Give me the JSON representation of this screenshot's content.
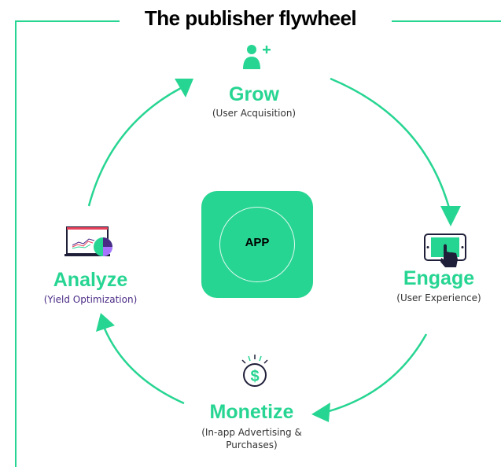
{
  "title": "The publisher flywheel",
  "center": {
    "label": "APP"
  },
  "nodes": {
    "grow": {
      "title": "Grow",
      "subtitle": "(User Acquisition)",
      "icon": "add-user-icon"
    },
    "engage": {
      "title": "Engage",
      "subtitle": "(User Experience)",
      "icon": "tablet-touch-icon"
    },
    "monetize": {
      "title": "Monetize",
      "subtitle_line1": "(In-app Advertising &",
      "subtitle_line2": "Purchases)",
      "icon": "dollar-coin-icon"
    },
    "analyze": {
      "title": "Analyze",
      "subtitle": "(Yield Optimization)",
      "icon": "analytics-chart-icon"
    }
  },
  "colors": {
    "accent": "#27d592",
    "dark": "#1f1f3a",
    "purple": "#4a2b86"
  }
}
